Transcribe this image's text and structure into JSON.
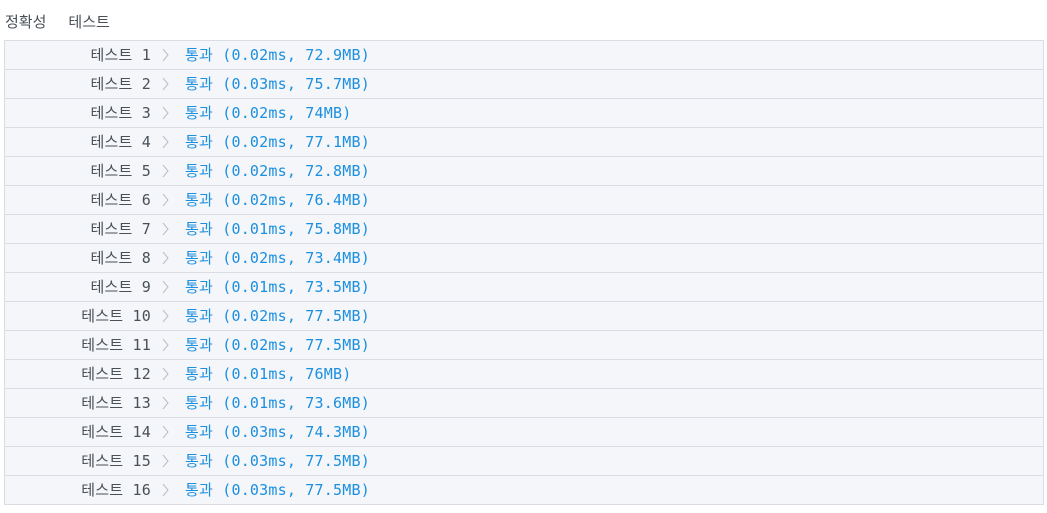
{
  "header": {
    "title1": "정확성",
    "title2": "테스트"
  },
  "tests": [
    {
      "label": "테스트 1",
      "result": "통과 (0.02ms, 72.9MB)"
    },
    {
      "label": "테스트 2",
      "result": "통과 (0.03ms, 75.7MB)"
    },
    {
      "label": "테스트 3",
      "result": "통과 (0.02ms, 74MB)"
    },
    {
      "label": "테스트 4",
      "result": "통과 (0.02ms, 77.1MB)"
    },
    {
      "label": "테스트 5",
      "result": "통과 (0.02ms, 72.8MB)"
    },
    {
      "label": "테스트 6",
      "result": "통과 (0.02ms, 76.4MB)"
    },
    {
      "label": "테스트 7",
      "result": "통과 (0.01ms, 75.8MB)"
    },
    {
      "label": "테스트 8",
      "result": "통과 (0.02ms, 73.4MB)"
    },
    {
      "label": "테스트 9",
      "result": "통과 (0.01ms, 73.5MB)"
    },
    {
      "label": "테스트 10",
      "result": "통과 (0.02ms, 77.5MB)"
    },
    {
      "label": "테스트 11",
      "result": "통과 (0.02ms, 77.5MB)"
    },
    {
      "label": "테스트 12",
      "result": "통과 (0.01ms, 76MB)"
    },
    {
      "label": "테스트 13",
      "result": "통과 (0.01ms, 73.6MB)"
    },
    {
      "label": "테스트 14",
      "result": "통과 (0.03ms, 74.3MB)"
    },
    {
      "label": "테스트 15",
      "result": "통과 (0.03ms, 77.5MB)"
    },
    {
      "label": "테스트 16",
      "result": "통과 (0.03ms, 77.5MB)"
    }
  ],
  "colors": {
    "pass": "#1b8fe0",
    "label": "#495057",
    "row_bg": "#f5f6f9",
    "border": "#d9dde3"
  },
  "icons": {
    "row_separator": "chevron-right-icon"
  }
}
